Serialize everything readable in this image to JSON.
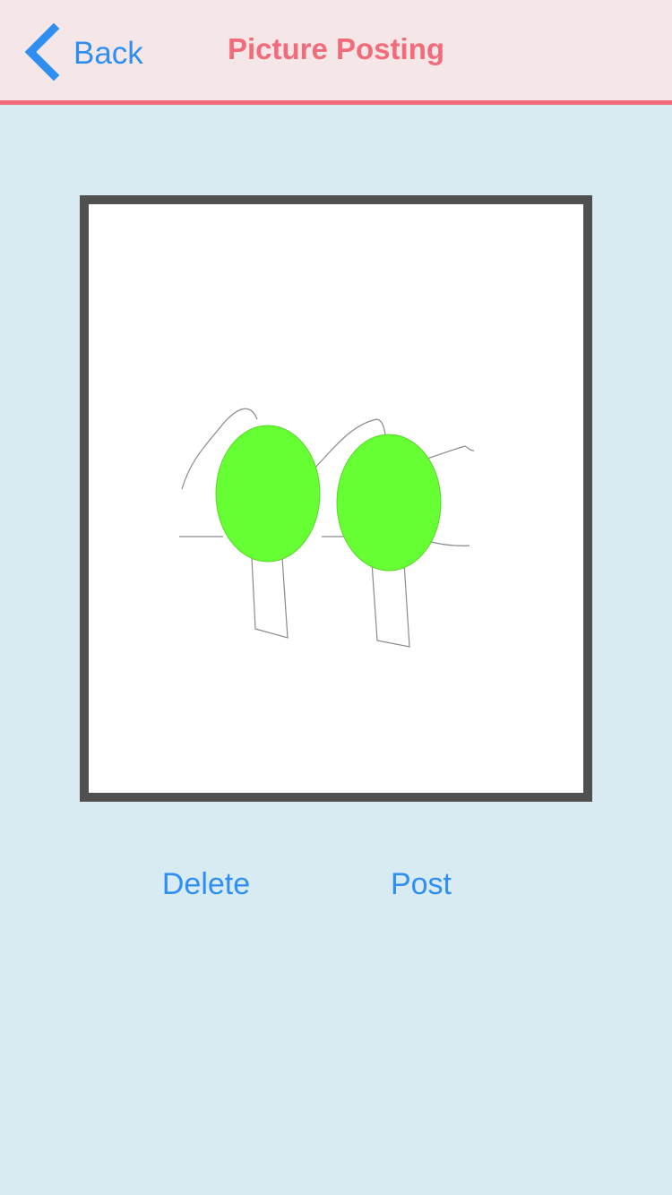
{
  "navbar": {
    "back_label": "Back",
    "title": "Picture Posting"
  },
  "actions": {
    "delete_label": "Delete",
    "post_label": "Post"
  },
  "colors": {
    "navbar_background": "#f5e7e8",
    "accent_pink": "#f26b7b",
    "link_blue": "#2f8ff0",
    "page_background": "#d8ebf3",
    "frame_border": "#505050",
    "shape_fill": "#66ff33"
  },
  "icons": {
    "back": "chevron-left-icon"
  }
}
